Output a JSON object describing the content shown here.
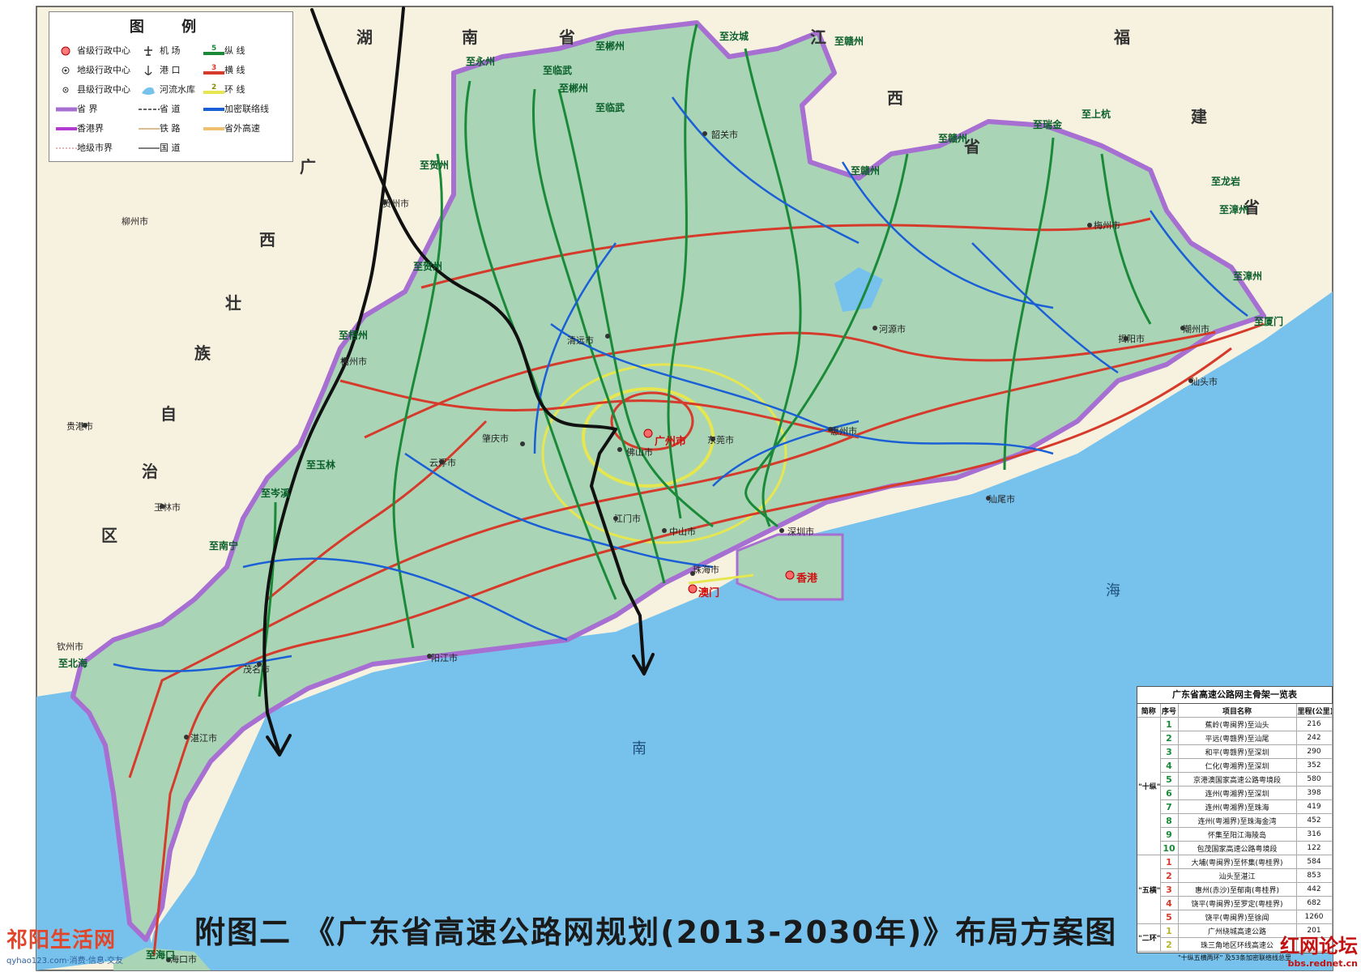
{
  "title": "附图二 《广东省高速公路网规划(2013-2030年)》布局方案图",
  "legend": {
    "title": "图 例",
    "items": [
      {
        "label": "省级行政中心",
        "icon": "provincial-capital-icon"
      },
      {
        "label": "机 场",
        "icon": "airport-icon"
      },
      {
        "label": "纵 线",
        "icon": "vertical-route-icon",
        "badge": "5"
      },
      {
        "label": "地级行政中心",
        "icon": "prefecture-city-icon"
      },
      {
        "label": "港 口",
        "icon": "port-icon"
      },
      {
        "label": "横 线",
        "icon": "horizontal-route-icon",
        "badge": "3"
      },
      {
        "label": "县级行政中心",
        "icon": "county-city-icon"
      },
      {
        "label": "河流水库",
        "icon": "river-icon"
      },
      {
        "label": "环 线",
        "icon": "ring-route-icon",
        "badge": "2"
      },
      {
        "label": "省 界",
        "icon": "province-border-icon"
      },
      {
        "label": "省 道",
        "icon": "provincial-road-icon"
      },
      {
        "label": "加密联络线",
        "icon": "link-route-icon"
      },
      {
        "label": "香港界",
        "icon": "hk-border-icon"
      },
      {
        "label": "铁 路",
        "icon": "railway-icon"
      },
      {
        "label": "省外高速",
        "icon": "external-expressway-icon"
      },
      {
        "label": "地级市界",
        "icon": "city-border-icon"
      },
      {
        "label": "国 道",
        "icon": "national-road-icon"
      }
    ]
  },
  "colors": {
    "land": "#a9d5b6",
    "sea": "#77c2ed",
    "outside": "#f7f1df",
    "vertical": "#1a8a38",
    "horizontal": "#d63a2a",
    "ring": "#e6e650",
    "link": "#1a5fd6",
    "border": "#a66fd1"
  },
  "regions": [
    {
      "name": "湖",
      "id": "hu"
    },
    {
      "name": "南",
      "id": "nan1"
    },
    {
      "name": "省",
      "id": "sheng1"
    },
    {
      "name": "江",
      "id": "jiang"
    },
    {
      "name": "西",
      "id": "xi1"
    },
    {
      "name": "省",
      "id": "sheng2"
    },
    {
      "name": "福",
      "id": "fu"
    },
    {
      "name": "建",
      "id": "jian"
    },
    {
      "name": "省",
      "id": "sheng3"
    },
    {
      "name": "广",
      "id": "guang"
    },
    {
      "name": "西",
      "id": "xi2"
    },
    {
      "name": "壮",
      "id": "zhuang"
    },
    {
      "name": "族",
      "id": "zu"
    },
    {
      "name": "自",
      "id": "zi"
    },
    {
      "name": "治",
      "id": "zhi"
    },
    {
      "name": "区",
      "id": "qu"
    },
    {
      "name": "海",
      "id": "hai"
    },
    {
      "name": "南",
      "id": "nan2"
    }
  ],
  "cities_major": [
    {
      "name": "广州市",
      "id": "guangzhou"
    },
    {
      "name": "香港",
      "id": "hongkong"
    },
    {
      "name": "澳门",
      "id": "macau"
    }
  ],
  "cities": [
    {
      "name": "韶关市",
      "id": "shaoguan"
    },
    {
      "name": "清远市",
      "id": "qingyuan"
    },
    {
      "name": "肇庆市",
      "id": "zhaoqing"
    },
    {
      "name": "佛山市",
      "id": "foshan"
    },
    {
      "name": "东莞市",
      "id": "dongguan"
    },
    {
      "name": "惠州市",
      "id": "huizhou"
    },
    {
      "name": "深圳市",
      "id": "shenzhen"
    },
    {
      "name": "中山市",
      "id": "zhongshan"
    },
    {
      "name": "珠海市",
      "id": "zhuhai"
    },
    {
      "name": "江门市",
      "id": "jiangmen"
    },
    {
      "name": "云浮市",
      "id": "yunfu"
    },
    {
      "name": "阳江市",
      "id": "yangjiang"
    },
    {
      "name": "茂名市",
      "id": "maoming"
    },
    {
      "name": "湛江市",
      "id": "zhanjiang"
    },
    {
      "name": "河源市",
      "id": "heyuan"
    },
    {
      "name": "梅州市",
      "id": "meizhou"
    },
    {
      "name": "潮州市",
      "id": "chaozhou"
    },
    {
      "name": "揭阳市",
      "id": "jieyang"
    },
    {
      "name": "汕头市",
      "id": "shantou"
    },
    {
      "name": "汕尾市",
      "id": "shanwei"
    },
    {
      "name": "梧州市",
      "id": "wuzhou"
    },
    {
      "name": "贺州市",
      "id": "hezhou"
    },
    {
      "name": "玉林市",
      "id": "yulin"
    },
    {
      "name": "贵港市",
      "id": "guigang"
    },
    {
      "name": "柳州市",
      "id": "liuzhou"
    },
    {
      "name": "钦州市",
      "id": "qinzhou"
    },
    {
      "name": "海口市",
      "id": "haikou"
    }
  ],
  "exits": [
    {
      "name": "至郴州",
      "id": "ex-chenzhou1"
    },
    {
      "name": "至汝城",
      "id": "ex-rucheng"
    },
    {
      "name": "至赣州",
      "id": "ex-ganzhou1"
    },
    {
      "name": "至永州",
      "id": "ex-yongzhou"
    },
    {
      "name": "至临武",
      "id": "ex-linwu1"
    },
    {
      "name": "至郴州",
      "id": "ex-chenzhou2"
    },
    {
      "name": "至临武",
      "id": "ex-linwu2"
    },
    {
      "name": "至贺州",
      "id": "ex-hezhou1"
    },
    {
      "name": "至贺州",
      "id": "ex-hezhou2"
    },
    {
      "name": "至梧州",
      "id": "ex-wuzhou"
    },
    {
      "name": "至玉林",
      "id": "ex-yulin"
    },
    {
      "name": "至岑溪",
      "id": "ex-cenxi"
    },
    {
      "name": "至南宁",
      "id": "ex-nanning"
    },
    {
      "name": "至北海",
      "id": "ex-beihai"
    },
    {
      "name": "至赣州",
      "id": "ex-ganzhou2"
    },
    {
      "name": "至赣州",
      "id": "ex-ganzhou3"
    },
    {
      "name": "至瑞金",
      "id": "ex-ruijin"
    },
    {
      "name": "至上杭",
      "id": "ex-shanghang"
    },
    {
      "name": "至龙岩",
      "id": "ex-longyan"
    },
    {
      "name": "至漳州",
      "id": "ex-zhangzhou1"
    },
    {
      "name": "至漳州",
      "id": "ex-zhangzhou2"
    },
    {
      "name": "至厦门",
      "id": "ex-xiamen"
    },
    {
      "name": "至海口",
      "id": "ex-haikou"
    }
  ],
  "route_table": {
    "title": "广东省高速公路网主骨架一览表",
    "headers": [
      "简称",
      "序号",
      "项目名称",
      "里程(公里)"
    ],
    "groups": [
      {
        "name": "\"十纵\"",
        "rows": [
          {
            "no": "1",
            "name": "蕉岭(粤闽界)至汕头",
            "km": "216"
          },
          {
            "no": "2",
            "name": "平远(粤赣界)至汕尾",
            "km": "242"
          },
          {
            "no": "3",
            "name": "和平(粤赣界)至深圳",
            "km": "290"
          },
          {
            "no": "4",
            "name": "仁化(粤湘界)至深圳",
            "km": "352"
          },
          {
            "no": "5",
            "name": "京港澳国家高速公路粤境段",
            "km": "580"
          },
          {
            "no": "6",
            "name": "连州(粤湘界)至深圳",
            "km": "398"
          },
          {
            "no": "7",
            "name": "连州(粤湘界)至珠海",
            "km": "419"
          },
          {
            "no": "8",
            "name": "连州(粤湘界)至珠海金湾",
            "km": "452"
          },
          {
            "no": "9",
            "name": "怀集至阳江海陵岛",
            "km": "316"
          },
          {
            "no": "10",
            "name": "包茂国家高速公路粤境段",
            "km": "122"
          }
        ]
      },
      {
        "name": "\"五横\"",
        "rows": [
          {
            "no": "1",
            "name": "大埔(粤闽界)至怀集(粤桂界)",
            "km": "584"
          },
          {
            "no": "2",
            "name": "汕头至湛江",
            "km": "853"
          },
          {
            "no": "3",
            "name": "惠州(赤沙)至郁南(粤桂界)",
            "km": "442"
          },
          {
            "no": "4",
            "name": "饶平(粤闽界)至罗定(粤桂界)",
            "km": "682"
          },
          {
            "no": "5",
            "name": "饶平(粤闽界)至徐闻",
            "km": "1260"
          }
        ]
      },
      {
        "name": "\"二环\"",
        "rows": [
          {
            "no": "1",
            "name": "广州绕城高速公路",
            "km": "201"
          },
          {
            "no": "2",
            "name": "珠三角地区环线高速公",
            "km": ""
          }
        ]
      }
    ],
    "footer": "\"十纵五横两环\" 及53条加密联络线总里"
  },
  "watermark_left": {
    "brand": "祁阳生活网",
    "site": "qyhao123.com·消费·信息·交友"
  },
  "watermark_right": {
    "brand": "红网论坛",
    "site": "bbs.rednet.cn"
  }
}
